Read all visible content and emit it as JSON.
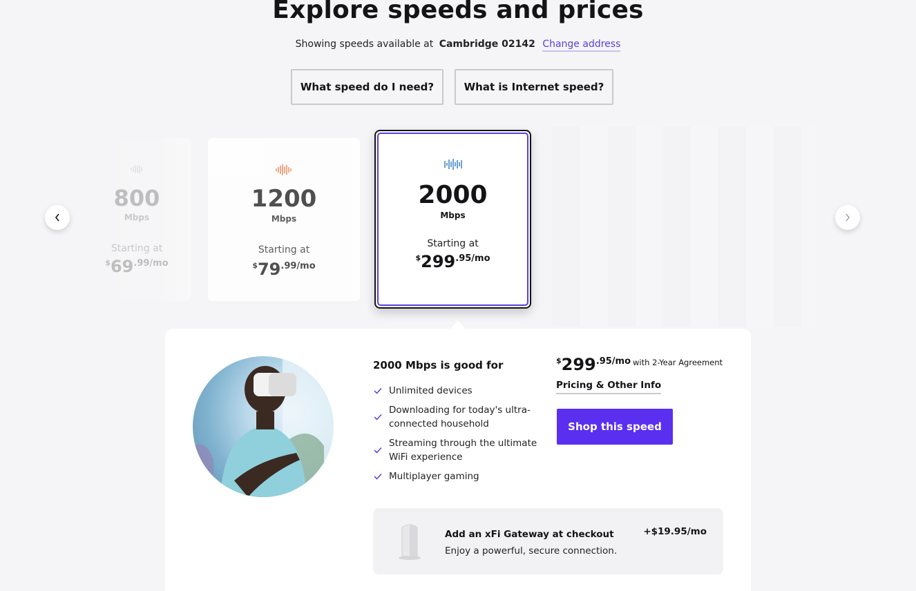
{
  "header": {
    "title": "Explore speeds and prices",
    "showing_prefix": "Showing speeds available at",
    "location": "Cambridge 02142",
    "change_address": "Change address"
  },
  "info_buttons": {
    "speed_need": "What speed do I need?",
    "internet_speed": "What is Internet speed?"
  },
  "cards": [
    {
      "speed": "800",
      "unit": "Mbps",
      "starting": "Starting at",
      "dollar": "$",
      "price": "69",
      "cents": ".99",
      "per": "/mo",
      "wave_color": "#9a9aa8"
    },
    {
      "speed": "1200",
      "unit": "Mbps",
      "starting": "Starting at",
      "dollar": "$",
      "price": "79",
      "cents": ".99",
      "per": "/mo",
      "wave_color": "#e06a2b"
    },
    {
      "speed": "2000",
      "unit": "Mbps",
      "starting": "Starting at",
      "dollar": "$",
      "price": "299",
      "cents": ".95",
      "per": "/mo",
      "wave_color": "#1e6fb8"
    }
  ],
  "detail": {
    "good_for_title": "2000 Mbps is good for",
    "features": [
      "Unlimited devices",
      "Downloading for today's ultra-connected household",
      "Streaming through the ultimate WiFi experience",
      "Multiplayer gaming"
    ],
    "price_dollar": "$",
    "price": "299",
    "price_cents": ".95",
    "price_per": "/mo",
    "agreement": "with 2-Year Agreement",
    "pricing_link": "Pricing & Other Info",
    "shop_button": "Shop this speed",
    "gateway_title": "Add an xFi Gateway at checkout",
    "gateway_desc": "Enjoy a powerful, secure connection.",
    "gateway_price": "+$19.95/mo"
  },
  "colors": {
    "accent": "#5a2ff0",
    "link": "#5a3fd8",
    "selected_border": "#5a3fd8"
  }
}
